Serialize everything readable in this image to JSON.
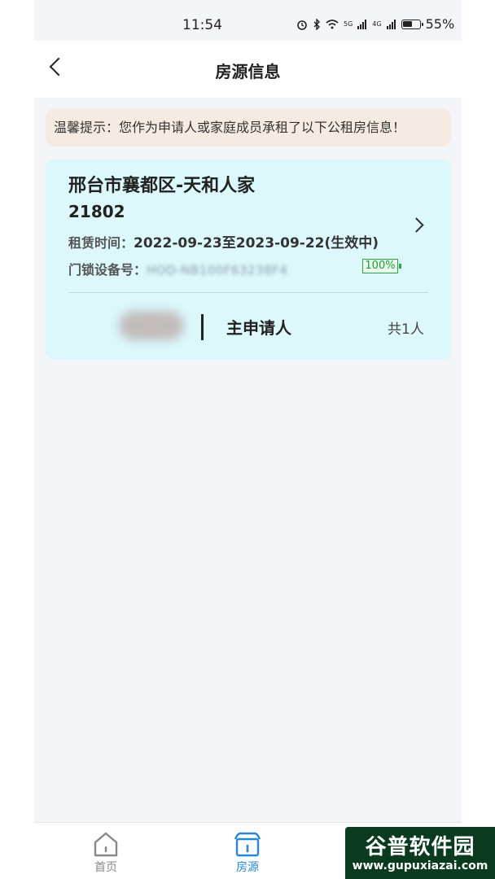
{
  "status_bar": {
    "time": "11:54",
    "network_labels": [
      "5G",
      "4G"
    ],
    "battery": "55%"
  },
  "header": {
    "title": "房源信息"
  },
  "tip": {
    "text": "温馨提示：您作为申请人或家庭成员承租了以下公租房信息！"
  },
  "property": {
    "title": "邢台市襄都区-天和人家",
    "unit": "21802",
    "lease_label": "租赁时间：",
    "lease_value": "2022-09-23至2023-09-22(生效中)",
    "lock_label": "门锁设备号：",
    "lock_value": "HOD-NB100F63238F4",
    "lock_battery": "100%",
    "member_role": "主申请人",
    "member_count": "共1人"
  },
  "tabbar": {
    "tabs": [
      {
        "label": "首页",
        "icon": "home-icon",
        "active": false
      },
      {
        "label": "房源",
        "icon": "house-icon",
        "active": true
      }
    ],
    "active_color": "#2a86d6",
    "inactive_color": "#888888"
  },
  "watermark": {
    "title": "谷普软件园",
    "url": "www.gupuxiazai.com"
  }
}
